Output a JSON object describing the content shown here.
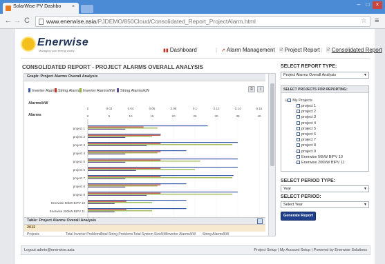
{
  "browser": {
    "tab_title": "SolarWise PV Dashbo",
    "tab_close": "×",
    "url_host": "www.enerwise.asia",
    "url_path": "/PJDEMO/850Cloud/Consolidated_Report_ProjectAlarm.html",
    "back_icon": "←",
    "forward_icon": "→",
    "reload_icon": "C",
    "star_icon": "☆",
    "menu_icon": "≡",
    "min_icon": "–",
    "max_icon": "□",
    "close_icon": "×"
  },
  "logo": {
    "text": "Enerwise",
    "tagline": "Managing your energy wisely"
  },
  "nav": {
    "dashboard": "Dashboard",
    "alarm_management": "Alarm Management",
    "project_report": "Project Report",
    "consolidated_report": "Consolidated Report",
    "separator": "|"
  },
  "report_title": "CONSOLIDATED REPORT - PROJECT ALARMS OVERALL ANALYSIS",
  "graph_header": "Graph: Project Alarms Overall Analysis",
  "legend": [
    {
      "label": "Inverter Alarms",
      "color": "#3a5aa6"
    },
    {
      "label": "String Alarms",
      "color": "#c0392b"
    },
    {
      "label": "Inverter Alarms/kW",
      "color": "#8db23a"
    },
    {
      "label": "String Alarms/kW",
      "color": "#5e4c8a"
    }
  ],
  "chart_buttons": {
    "print": "⎙",
    "download": "⤓"
  },
  "chart_data": {
    "type": "bar",
    "orientation": "horizontal",
    "axis_top_label": "Alarms/kW",
    "axis_bottom_label": "Alarms",
    "top_ticks": [
      "0",
      "0.02",
      "0.04",
      "0.06",
      "0.08",
      "0.1",
      "0.12",
      "0.14",
      "0.16"
    ],
    "bottom_ticks": [
      "0",
      "5",
      "10",
      "15",
      "20",
      "25",
      "30",
      "35",
      "40"
    ],
    "categories": [
      "project 1",
      "project 2",
      "project 3",
      "project 4",
      "project 5",
      "project 6",
      "project 7",
      "project 8",
      "project 9",
      "Enerwise 50kW BIPV 10",
      "Enerwise 200kW BIPV 11"
    ],
    "xlim_alarms": [
      0,
      40
    ],
    "xlim_per_kw": [
      0,
      0.16
    ],
    "series": [
      {
        "name": "Inverter Alarms",
        "axis": "alarms",
        "values": [
          28,
          17,
          35,
          23,
          35,
          35,
          34,
          23,
          35,
          23,
          23
        ]
      },
      {
        "name": "String Alarms",
        "axis": "alarms",
        "values": [
          13,
          17,
          17,
          17,
          17,
          17,
          17,
          17,
          17,
          9,
          9
        ]
      },
      {
        "name": "Inverter Alarms/kW",
        "axis": "per_kw",
        "values": [
          0.065,
          0.06,
          0.135,
          0.065,
          0.105,
          0.1,
          0.135,
          0.065,
          0.135,
          0.06,
          0.06
        ]
      },
      {
        "name": "String Alarms/kW",
        "axis": "per_kw",
        "values": [
          0.035,
          0.035,
          0.055,
          0.035,
          0.035,
          0.045,
          0.035,
          0.035,
          0.055,
          0.025,
          0.025
        ]
      }
    ]
  },
  "table": {
    "header": "Table: Project Alarms Overall Analysis",
    "year": "2012",
    "columns": [
      "Projects",
      "Total Inverter Problems",
      "Total String Problems",
      "Total System Size/kW",
      "Inverter Alarms/kW",
      "String Alarms/kW"
    ]
  },
  "right_panel": {
    "report_type_label": "SELECT REPORT TYPE:",
    "report_type_value": "Project Alarms Overall Analysis",
    "projects_header": "SELECT PROJECTS FOR REPORTING:",
    "tree_root": "My Projects",
    "tree_expander": "⊟",
    "projects": [
      "project 1",
      "project 2",
      "project 3",
      "project 4",
      "project 5",
      "project 6",
      "project 7",
      "project 8",
      "project 9",
      "Enerwise 50kW BIPV 10",
      "Enerwise 200kW BIPV 11"
    ],
    "period_type_label": "SELECT PERIOD TYPE:",
    "period_type_value": "Year",
    "period_label": "SELECT PERIOD:",
    "period_value": "Select Year",
    "generate_button": "Generate Report",
    "select_arrow": "▼"
  },
  "footer": {
    "logout": "Logout admin@enerwise.asia",
    "links": "Project Setup  |  My Account Setup  |  Powered by Enerwise Solutions"
  }
}
